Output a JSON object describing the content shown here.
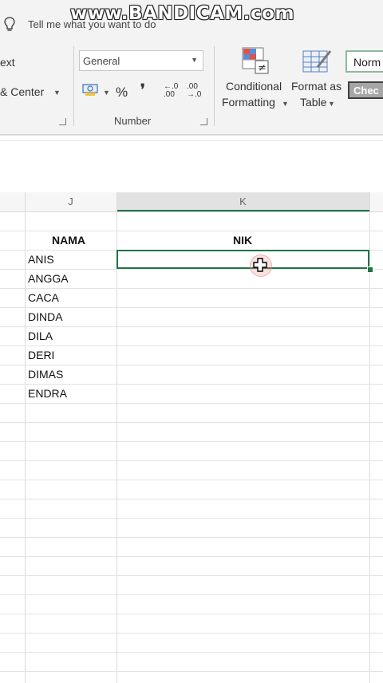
{
  "watermark": "www.BANDICAM.com",
  "tell_me": "Tell me what you want to do",
  "ribbon": {
    "alignment": {
      "wrap_text_partial": "ext",
      "merge_center_partial": "& Center"
    },
    "number": {
      "format_value": "General",
      "currency_icon": "accounting-format-icon",
      "percent": "%",
      "comma": "❜",
      "increase_decimal": "←.0\n.00",
      "decrease_decimal": ".00\n→.0",
      "group_label": "Number"
    },
    "styles": {
      "conditional_formatting": "Conditional\nFormatting",
      "conditional_line1": "Conditional",
      "conditional_line2": "Formatting",
      "format_as_table_line1": "Format as",
      "format_as_table_line2": "Table",
      "normal_style": "Norm",
      "check_cell_style": "Chec"
    }
  },
  "columns": {
    "j": "J",
    "k": "K"
  },
  "sheet": {
    "header_nama": "NAMA",
    "header_nik": "NIK",
    "names": [
      "ANIS",
      "ANGGA",
      "CACA",
      "DINDA",
      "DILA",
      "DERI",
      "DIMAS",
      "ENDRA"
    ]
  },
  "colors": {
    "accent": "#217346",
    "ribbon_bg": "#f3f3f3"
  }
}
